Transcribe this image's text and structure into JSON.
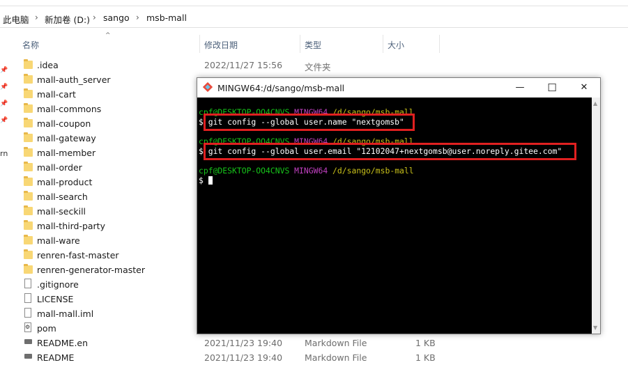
{
  "breadcrumb": [
    "此电脑",
    "新加卷 (D:)",
    "sango",
    "msb-mall"
  ],
  "columns": {
    "name": "名称",
    "modified": "修改日期",
    "type": "类型",
    "size": "大小"
  },
  "left_sidebar_fragment": "rn",
  "files": [
    {
      "name": ".idea",
      "date": "2022/11/27 15:56",
      "type": "文件夹",
      "size": "",
      "icon": "folder-icon"
    },
    {
      "name": "mall-auth_server",
      "date": "",
      "type": "",
      "size": "",
      "icon": "folder-icon"
    },
    {
      "name": "mall-cart",
      "date": "",
      "type": "",
      "size": "",
      "icon": "folder-icon"
    },
    {
      "name": "mall-commons",
      "date": "",
      "type": "",
      "size": "",
      "icon": "folder-icon"
    },
    {
      "name": "mall-coupon",
      "date": "",
      "type": "",
      "size": "",
      "icon": "folder-icon"
    },
    {
      "name": "mall-gateway",
      "date": "",
      "type": "",
      "size": "",
      "icon": "folder-icon"
    },
    {
      "name": "mall-member",
      "date": "",
      "type": "",
      "size": "",
      "icon": "folder-icon"
    },
    {
      "name": "mall-order",
      "date": "",
      "type": "",
      "size": "",
      "icon": "folder-icon"
    },
    {
      "name": "mall-product",
      "date": "",
      "type": "",
      "size": "",
      "icon": "folder-icon"
    },
    {
      "name": "mall-search",
      "date": "",
      "type": "",
      "size": "",
      "icon": "folder-icon"
    },
    {
      "name": "mall-seckill",
      "date": "",
      "type": "",
      "size": "",
      "icon": "folder-icon"
    },
    {
      "name": "mall-third-party",
      "date": "",
      "type": "",
      "size": "",
      "icon": "folder-icon"
    },
    {
      "name": "mall-ware",
      "date": "",
      "type": "",
      "size": "",
      "icon": "folder-icon"
    },
    {
      "name": "renren-fast-master",
      "date": "",
      "type": "",
      "size": "",
      "icon": "folder-icon"
    },
    {
      "name": "renren-generator-master",
      "date": "",
      "type": "",
      "size": "",
      "icon": "folder-icon"
    },
    {
      "name": ".gitignore",
      "date": "",
      "type": "",
      "size": "",
      "icon": "file-icon"
    },
    {
      "name": "LICENSE",
      "date": "",
      "type": "",
      "size": "",
      "icon": "file-icon"
    },
    {
      "name": "mall-mall.iml",
      "date": "",
      "type": "",
      "size": "",
      "icon": "file-icon"
    },
    {
      "name": "pom",
      "date": "",
      "type": "",
      "size": "",
      "icon": "xml-file-icon"
    },
    {
      "name": "README.en",
      "date": "2021/11/23 19:40",
      "type": "Markdown File",
      "size": "1 KB",
      "icon": "markdown-file-icon"
    },
    {
      "name": "README",
      "date": "2021/11/23 19:40",
      "type": "Markdown File",
      "size": "1 KB",
      "icon": "markdown-file-icon"
    }
  ],
  "terminal": {
    "title": "MINGW64:/d/sango/msb-mall",
    "controls": {
      "minimize": "—",
      "maximize": "☐",
      "close": "✕"
    },
    "lines": [
      {
        "user": "cpf@DESKTOP-OO4CNVS",
        "shell": "MINGW64",
        "path": "/d/sango/msb-mall"
      },
      {
        "cmd": "$ git config --global user.name \"nextgomsb\""
      },
      {
        "user": "cpf@DESKTOP-OO4CNVS",
        "shell": "MINGW64",
        "path": "/d/sango/msb-mall"
      },
      {
        "cmd": "$ git config --global user.email \"12102047+nextgomsb@user.noreply.gitee.com\""
      },
      {
        "user": "cpf@DESKTOP-OO4CNVS",
        "shell": "MINGW64",
        "path": "/d/sango/msb-mall"
      },
      {
        "cmd": "$ "
      }
    ]
  },
  "colors": {
    "highlight": "#e02020",
    "prompt_user": "#17c41a",
    "prompt_shell": "#c040c0",
    "prompt_path": "#c8c01a",
    "folder": "#f8d775"
  }
}
